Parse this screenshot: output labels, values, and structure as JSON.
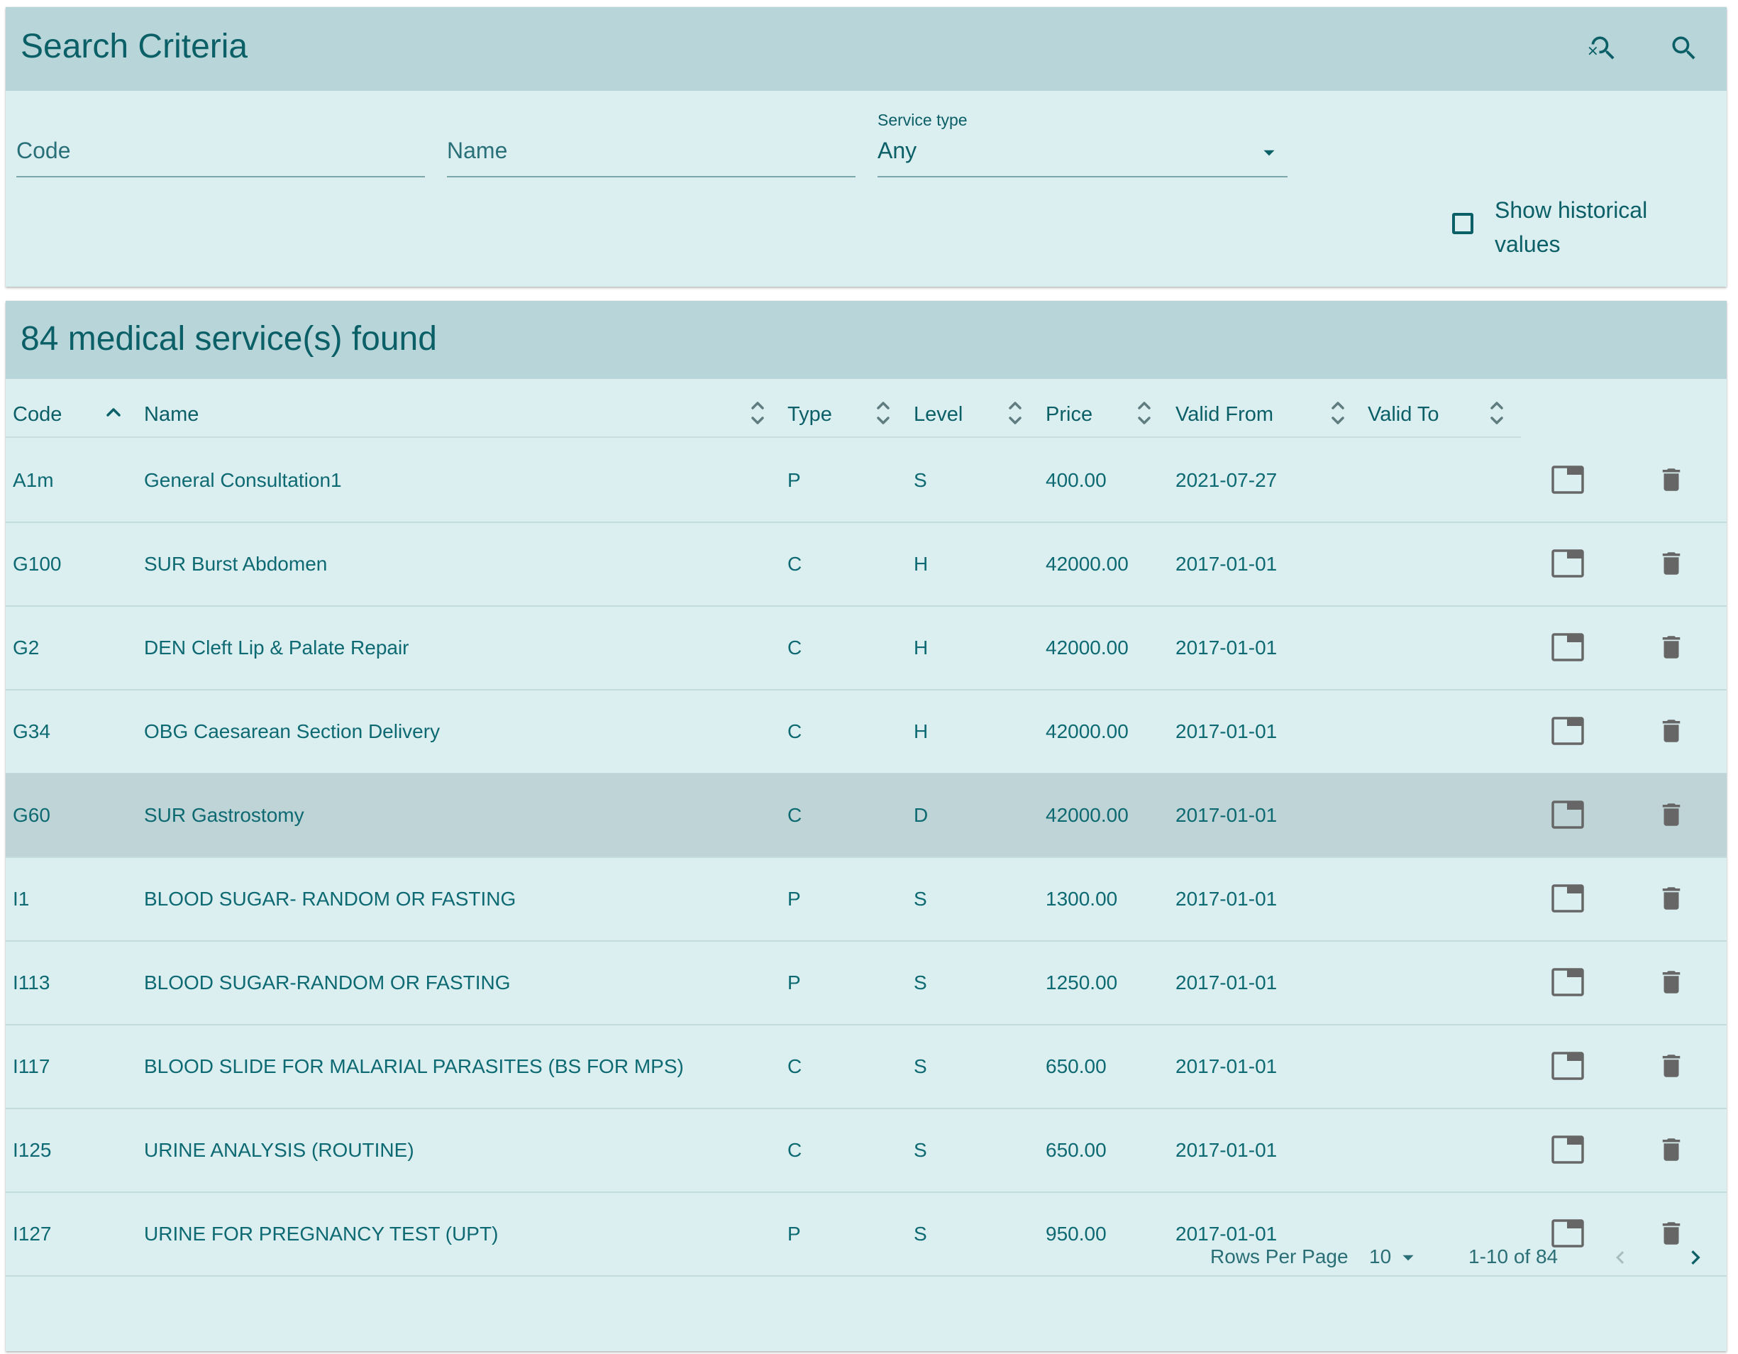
{
  "search": {
    "title": "Search Criteria",
    "code_placeholder": "Code",
    "name_placeholder": "Name",
    "service_type_label": "Service type",
    "service_type_value": "Any",
    "show_historical_label": "Show historical values",
    "show_historical_checked": false,
    "icons": [
      "reset-search-icon",
      "search-icon"
    ]
  },
  "results": {
    "title": "84 medical service(s) found",
    "columns": [
      "Code",
      "Name",
      "Type",
      "Level",
      "Price",
      "Valid From",
      "Valid To"
    ],
    "sorted_column": "Code",
    "sort_direction": "ascending",
    "highlighted_row": 4,
    "rows": [
      {
        "code": "A1m",
        "name": "General Consultation1",
        "type": "P",
        "level": "S",
        "price": "400.00",
        "valid_from": "2021-07-27",
        "valid_to": ""
      },
      {
        "code": "G100",
        "name": "SUR Burst Abdomen",
        "type": "C",
        "level": "H",
        "price": "42000.00",
        "valid_from": "2017-01-01",
        "valid_to": ""
      },
      {
        "code": "G2",
        "name": "DEN Cleft Lip & Palate Repair",
        "type": "C",
        "level": "H",
        "price": "42000.00",
        "valid_from": "2017-01-01",
        "valid_to": ""
      },
      {
        "code": "G34",
        "name": "OBG Caesarean Section Delivery",
        "type": "C",
        "level": "H",
        "price": "42000.00",
        "valid_from": "2017-01-01",
        "valid_to": ""
      },
      {
        "code": "G60",
        "name": "SUR Gastrostomy",
        "type": "C",
        "level": "D",
        "price": "42000.00",
        "valid_from": "2017-01-01",
        "valid_to": ""
      },
      {
        "code": "I1",
        "name": "BLOOD SUGAR- RANDOM OR FASTING",
        "type": "P",
        "level": "S",
        "price": "1300.00",
        "valid_from": "2017-01-01",
        "valid_to": ""
      },
      {
        "code": "I113",
        "name": "BLOOD SUGAR-RANDOM OR FASTING",
        "type": "P",
        "level": "S",
        "price": "1250.00",
        "valid_from": "2017-01-01",
        "valid_to": ""
      },
      {
        "code": "I117",
        "name": "BLOOD SLIDE FOR MALARIAL PARASITES (BS FOR MPS)",
        "type": "C",
        "level": "S",
        "price": "650.00",
        "valid_from": "2017-01-01",
        "valid_to": ""
      },
      {
        "code": "I125",
        "name": "URINE ANALYSIS (ROUTINE)",
        "type": "C",
        "level": "S",
        "price": "650.00",
        "valid_from": "2017-01-01",
        "valid_to": ""
      },
      {
        "code": "I127",
        "name": "URINE FOR PREGNANCY TEST (UPT)",
        "type": "P",
        "level": "S",
        "price": "950.00",
        "valid_from": "2017-01-01",
        "valid_to": ""
      }
    ],
    "row_action_icons": [
      "open-in-new-tab-icon",
      "delete-icon"
    ]
  },
  "pagination": {
    "rows_per_page_label": "Rows Per Page",
    "rows_per_page_value": "10",
    "range_text": "1-10 of 84",
    "icons": [
      "chevron-left-icon",
      "chevron-right-icon"
    ]
  },
  "colors": {
    "header_bg": "#b8d6d9",
    "card_bg": "#dbeef0",
    "text": "#0b5f67",
    "row_highlight": "#bfd4d6",
    "icon_gray": "#666666"
  }
}
